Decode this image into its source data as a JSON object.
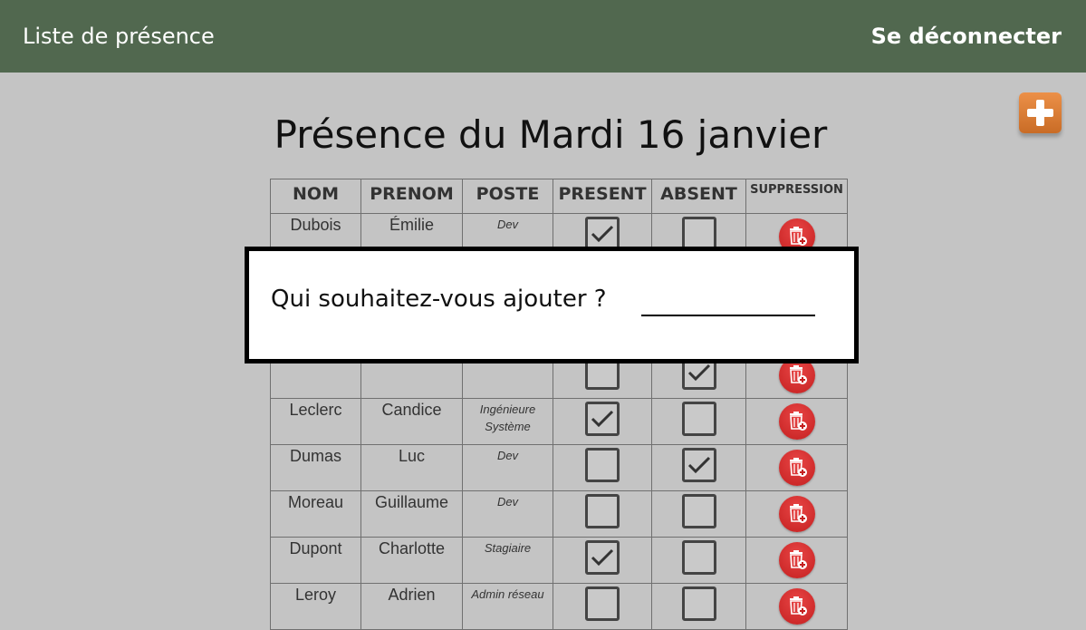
{
  "header": {
    "app_title": "Liste de présence",
    "logout_label": "Se déconnecter"
  },
  "page": {
    "title": "Présence du Mardi 16 janvier"
  },
  "table": {
    "headers": {
      "nom": "NOM",
      "prenom": "PRENOM",
      "poste": "POSTE",
      "present": "PRESENT",
      "absent": "ABSENT",
      "suppression": "SUPPRESSION"
    },
    "rows": [
      {
        "nom": "Dubois",
        "prenom": "Émilie",
        "poste": "Dev",
        "present": true,
        "absent": false
      },
      {
        "nom": "",
        "prenom": "",
        "poste": "",
        "present": false,
        "absent": false
      },
      {
        "nom": "",
        "prenom": "",
        "poste": "",
        "present": false,
        "absent": false
      },
      {
        "nom": "",
        "prenom": "",
        "poste": "",
        "present": false,
        "absent": true
      },
      {
        "nom": "Leclerc",
        "prenom": "Candice",
        "poste": "Ingénieure Système",
        "present": true,
        "absent": false
      },
      {
        "nom": "Dumas",
        "prenom": "Luc",
        "poste": "Dev",
        "present": false,
        "absent": true
      },
      {
        "nom": "Moreau",
        "prenom": "Guillaume",
        "poste": "Dev",
        "present": false,
        "absent": false
      },
      {
        "nom": "Dupont",
        "prenom": "Charlotte",
        "poste": "Stagiaire",
        "present": true,
        "absent": false
      },
      {
        "nom": "Leroy",
        "prenom": "Adrien",
        "poste": "Admin réseau",
        "present": false,
        "absent": false
      }
    ]
  },
  "modal": {
    "prompt": "Qui souhaitez-vous ajouter ?",
    "input_value": ""
  },
  "colors": {
    "header_bg": "#51684f",
    "page_bg": "#c4c4c4",
    "add_button": "#e07f36",
    "delete_button": "#d42a2a"
  },
  "icons": {
    "add": "plus-icon",
    "delete": "trash-icon",
    "check": "check-icon"
  }
}
